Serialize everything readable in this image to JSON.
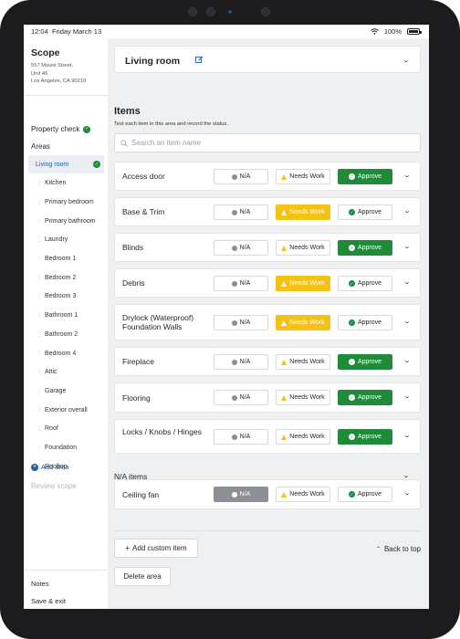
{
  "status_bar": {
    "time": "12:04",
    "date": "Friday March 13",
    "battery": "100%"
  },
  "sidebar": {
    "title": "Scope",
    "address_lines": [
      "557 Mount Street,",
      "Unit 46",
      "Los Angeles, CA 90210"
    ],
    "property_check": "Property check",
    "areas_label": "Areas",
    "areas": [
      "Living room",
      "Kitchen",
      "Primary bedroom",
      "Primary bathroom",
      "Laundry",
      "Bedroom 1",
      "Bedroom 2",
      "Bedroom 3",
      "Bathroom 1",
      "Bathroom 2",
      "Bedroom 4",
      "Attic",
      "Garage",
      "Exterior overall",
      "Roof",
      "Foundation",
      "Rooftop"
    ],
    "add_area": "Add area",
    "review_scope": "Review scope",
    "notes": "Notes",
    "save_exit": "Save & exit"
  },
  "header": {
    "title": "Living room"
  },
  "items_section": {
    "title": "Items",
    "subtitle": "Test each item in this area and record the status.",
    "search_placeholder": "Search an item name"
  },
  "buttons": {
    "na": "N/A",
    "needs_work": "Needs Work",
    "approve": "Approve"
  },
  "items": [
    {
      "name": "Access door",
      "status": "approve"
    },
    {
      "name": "Base & Trim",
      "status": "needs_work"
    },
    {
      "name": "Blinds",
      "status": "approve"
    },
    {
      "name": "Debris",
      "status": "needs_work"
    },
    {
      "name": "Drylock (Waterproof) Foundation Walls",
      "status": "needs_work"
    },
    {
      "name": "Fireplace",
      "status": "approve"
    },
    {
      "name": "Flooring",
      "status": "approve"
    },
    {
      "name": "Locks / Knobs / Hinges",
      "status": "approve"
    }
  ],
  "na_section": {
    "label": "N/A items"
  },
  "na_items": [
    {
      "name": "Ceiling fan",
      "status": "na"
    }
  ],
  "actions": {
    "add_custom": "Add custom item",
    "back_to_top": "Back to top",
    "delete_area": "Delete area"
  },
  "colors": {
    "approve": "#1f8a3a",
    "needs_work": "#f5c213",
    "na": "#8c8f93",
    "link": "#1f5fa6"
  }
}
